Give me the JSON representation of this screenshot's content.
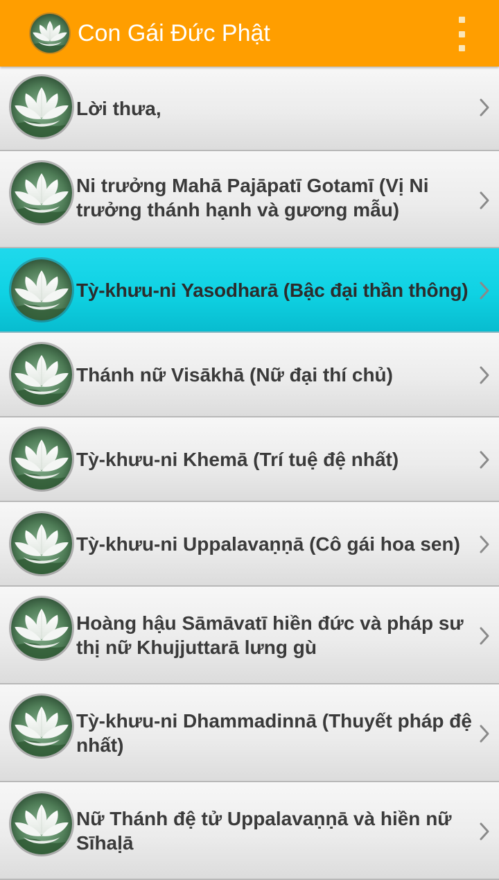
{
  "app_bar": {
    "title": "Con Gái Đức Phật",
    "icon": "lotus-icon",
    "overflow_icon": "more-vert-icon",
    "background": "#ff9e00"
  },
  "list": {
    "selected_background": "#0fd2e3",
    "items": [
      {
        "label": "Lời thưa,",
        "icon": "lotus-icon",
        "selected": false
      },
      {
        "label": "Ni trưởng Mahā Pajāpatī Gotamī (Vị Ni trưởng thánh hạnh và gương mẫu)",
        "icon": "lotus-icon",
        "selected": false
      },
      {
        "label": "Tỳ-khưu-ni Yasodharā (Bậc đại thần thông)",
        "icon": "lotus-icon",
        "selected": true
      },
      {
        "label": "Thánh nữ Visākhā (Nữ đại thí chủ)",
        "icon": "lotus-icon",
        "selected": false
      },
      {
        "label": "Tỳ-khưu-ni Khemā (Trí tuệ đệ nhất)",
        "icon": "lotus-icon",
        "selected": false
      },
      {
        "label": "Tỳ-khưu-ni Uppalavaṇṇā (Cô gái hoa sen)",
        "icon": "lotus-icon",
        "selected": false
      },
      {
        "label": "Hoàng hậu Sāmāvatī hiền đức và pháp sư thị nữ Khujjuttarā lưng gù",
        "icon": "lotus-icon",
        "selected": false
      },
      {
        "label": "Tỳ-khưu-ni Dhammadinnā (Thuyết pháp đệ nhất)",
        "icon": "lotus-icon",
        "selected": false
      },
      {
        "label": "Nữ Thánh đệ tử Uppalavaṇṇā và hiền nữ Sīhaḷā",
        "icon": "lotus-icon",
        "selected": false
      }
    ]
  }
}
